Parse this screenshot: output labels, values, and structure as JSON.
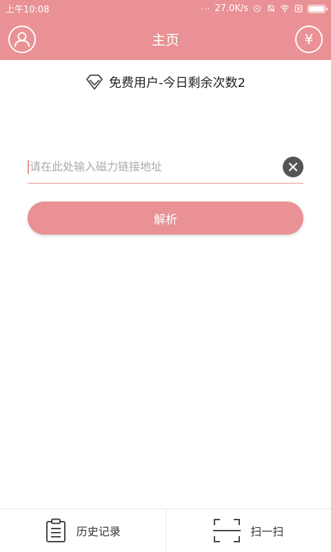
{
  "status_bar": {
    "time": "上午10:08",
    "dots": "···",
    "speed": "27.0K/s"
  },
  "header": {
    "title": "主页",
    "left_icon": "user-icon",
    "right_icon": "yuan-icon",
    "right_glyph": "¥"
  },
  "tier": {
    "icon": "diamond-icon",
    "text": "免费用户-今日剩余次数2"
  },
  "input": {
    "placeholder": "请在此处输入磁力链接地址",
    "value": ""
  },
  "parse_button": {
    "label": "解析"
  },
  "bottom_nav": {
    "items": [
      {
        "icon": "clipboard-icon",
        "label": "历史记录"
      },
      {
        "icon": "scan-icon",
        "label": "扫一扫"
      }
    ]
  },
  "colors": {
    "accent": "#e99194",
    "clear_button": "#555555"
  }
}
